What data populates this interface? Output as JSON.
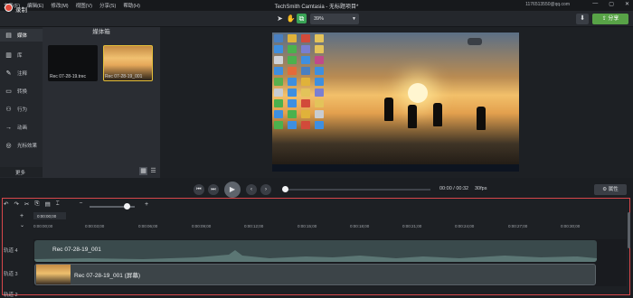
{
  "titlebar": {
    "menus": [
      "文件(F)",
      "编辑(E)",
      "修改(M)",
      "视图(V)",
      "分享(S)",
      "帮助(H)"
    ],
    "title": "TechSmith Camtasia - 无标题项目*",
    "account": "1176513550@qq.com",
    "window_controls": [
      "—",
      "▢",
      "✕"
    ]
  },
  "toolbar": {
    "record_label": "录制",
    "zoom_value": "39%",
    "share_label": "分享",
    "tools": [
      "cursor-arrow-icon",
      "hand-pan-icon",
      "crop-icon"
    ]
  },
  "leftnav": {
    "items": [
      {
        "label": "媒体",
        "icon": "media-icon"
      },
      {
        "label": "库",
        "icon": "library-icon"
      },
      {
        "label": "注释",
        "icon": "annotation-icon"
      },
      {
        "label": "转换",
        "icon": "transition-icon"
      },
      {
        "label": "行为",
        "icon": "behavior-icon"
      },
      {
        "label": "动画",
        "icon": "animation-icon"
      },
      {
        "label": "光标效果",
        "icon": "cursor-effect-icon"
      }
    ],
    "more_label": "更多",
    "add_symbol": "+"
  },
  "media_bin": {
    "title": "媒体箱",
    "items": [
      {
        "name": "Rec 07-28-19.trec"
      },
      {
        "name": "Rec 07-28-19_001"
      }
    ]
  },
  "playback": {
    "timecode": "00:00 / 00:32",
    "fps": "30fps",
    "properties_label": "属性"
  },
  "timeline": {
    "playhead_time": "0:00:00;00",
    "ticks": [
      "0:00:00;00",
      "0:00:03;00",
      "0:00:06;00",
      "0:00:09;00",
      "0:00:12;00",
      "0:00:15;00",
      "0:00:18;00",
      "0:00:21;00",
      "0:00:24;00",
      "0:00:27;00",
      "0:00:30;00"
    ],
    "tracks": [
      {
        "label": "轨道 4",
        "clip": "Rec 07-28-19_001"
      },
      {
        "label": "轨道 3",
        "clip": "Rec 07-28-19_001 (屏幕)"
      },
      {
        "label": "轨道 2"
      }
    ]
  }
}
